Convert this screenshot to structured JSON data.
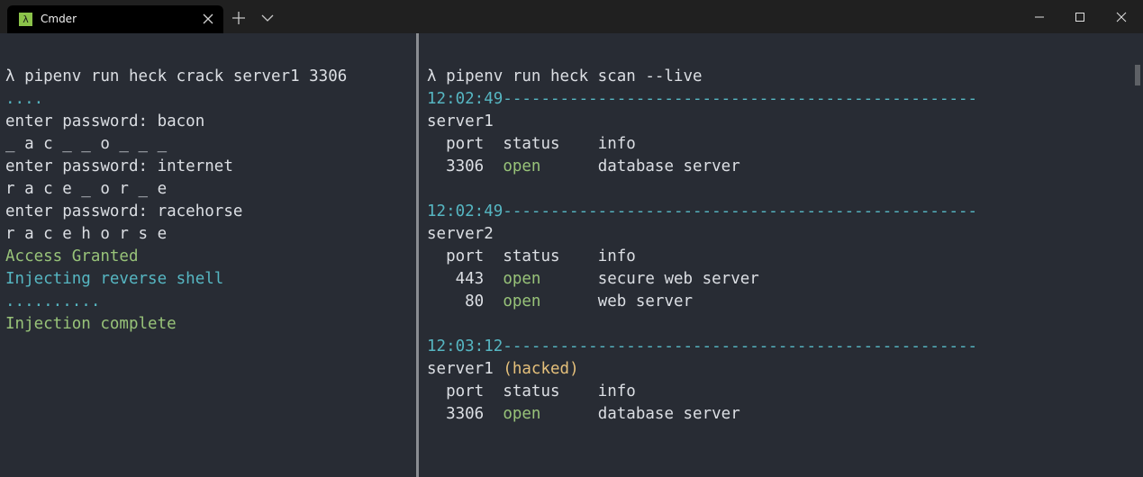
{
  "window": {
    "tab_title": "Cmder",
    "tab_icon": "lambda-icon",
    "tab_icon_glyph": "λ",
    "accent": "#8bc34a"
  },
  "left_pane": {
    "lines": [
      {
        "text": "λ pipenv run heck crack server1 3306",
        "color": "default"
      },
      {
        "text": "....",
        "color": "cyan"
      },
      {
        "text": "enter password: bacon",
        "color": "default"
      },
      {
        "text": "_ a c _ _ o _ _ _",
        "color": "default"
      },
      {
        "text": "enter password: internet",
        "color": "default"
      },
      {
        "text": "r a c e _ o r _ e",
        "color": "default"
      },
      {
        "text": "enter password: racehorse",
        "color": "default"
      },
      {
        "text": "r a c e h o r s e",
        "color": "default"
      },
      {
        "text": "Access Granted",
        "color": "green"
      },
      {
        "text": "Injecting reverse shell",
        "color": "cyan"
      },
      {
        "text": "..........",
        "color": "cyan"
      },
      {
        "text": "Injection complete",
        "color": "green"
      }
    ]
  },
  "right_pane": {
    "command": "λ pipenv run heck scan --live",
    "header": {
      "port": "port",
      "status": "status",
      "info": "info"
    },
    "scans": [
      {
        "time": "12:02:49",
        "rule": "--------------------------------------------------",
        "server": "server1",
        "tag": "",
        "rows": [
          {
            "port": "3306",
            "status": "open",
            "info": "database server"
          }
        ]
      },
      {
        "time": "12:02:49",
        "rule": "--------------------------------------------------",
        "server": "server2",
        "tag": "",
        "rows": [
          {
            "port": "443",
            "status": "open",
            "info": "secure web server"
          },
          {
            "port": "80",
            "status": "open",
            "info": "web server"
          }
        ]
      },
      {
        "time": "12:03:12",
        "rule": "--------------------------------------------------",
        "server": "server1",
        "tag": "(hacked)",
        "rows": [
          {
            "port": "3306",
            "status": "open",
            "info": "database server"
          }
        ]
      }
    ]
  },
  "colors": {
    "background": "#282c34",
    "foreground": "#dcdfe4",
    "green": "#98c379",
    "cyan": "#56b6c2",
    "yellow": "#e5c07b"
  }
}
